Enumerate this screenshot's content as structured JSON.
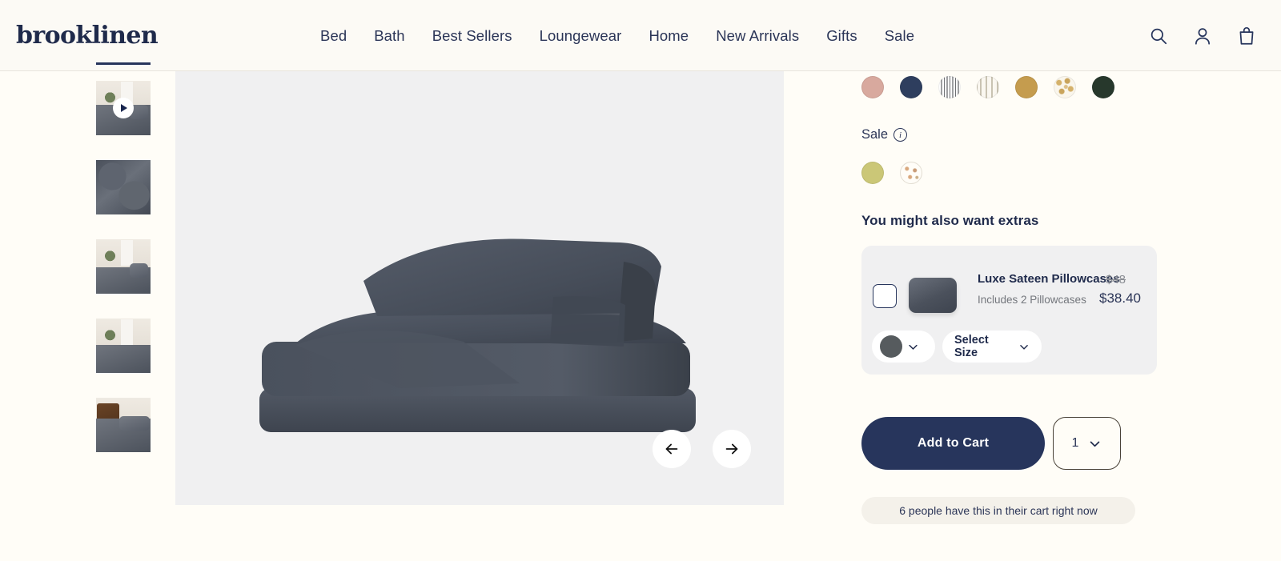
{
  "brand": {
    "logo_text": "brooklinen",
    "navy": "#27355C",
    "page_bg": "#FFFDF7"
  },
  "header": {
    "nav_items": [
      {
        "label": "Bed"
      },
      {
        "label": "Bath"
      },
      {
        "label": "Best Sellers"
      },
      {
        "label": "Loungewear"
      },
      {
        "label": "Home"
      },
      {
        "label": "New Arrivals"
      },
      {
        "label": "Gifts"
      },
      {
        "label": "Sale"
      }
    ],
    "icons": [
      {
        "name": "search-icon"
      },
      {
        "name": "account-icon"
      },
      {
        "name": "cart-bag-icon"
      }
    ]
  },
  "gallery": {
    "thumbnails": [
      {
        "name": "thumbnail-1-active",
        "kind": "active-indicator"
      },
      {
        "name": "thumbnail-2-video",
        "kind": "bedroom-video"
      },
      {
        "name": "thumbnail-3",
        "kind": "fabric-closeup"
      },
      {
        "name": "thumbnail-4",
        "kind": "bedroom-scene"
      },
      {
        "name": "thumbnail-5",
        "kind": "bedroom-scene"
      },
      {
        "name": "thumbnail-6",
        "kind": "headboard-scene"
      }
    ],
    "prev_label": "←",
    "next_label": "→",
    "hero_alt": "Stack of folded dark slate sheets"
  },
  "product": {
    "colors": [
      {
        "name": "blush",
        "hex": "#D8A99E",
        "type": "solid"
      },
      {
        "name": "navy",
        "hex": "#2E3E5E",
        "type": "solid"
      },
      {
        "name": "gray-stripe",
        "hex": "#9FA0A2",
        "type": "stripe-gray"
      },
      {
        "name": "beige-stripe",
        "hex": "#C9C3B2",
        "type": "stripe-beige"
      },
      {
        "name": "gold",
        "hex": "#C59C4E",
        "type": "solid"
      },
      {
        "name": "gold-floral",
        "hex": "#D4B16A",
        "type": "floral-gold"
      },
      {
        "name": "forest-green",
        "hex": "#27382C",
        "type": "solid"
      }
    ],
    "sale": {
      "label": "Sale",
      "info_icon": "info-icon",
      "colors": [
        {
          "name": "olive",
          "hex": "#CBC777",
          "type": "solid"
        },
        {
          "name": "white-floral",
          "hex": "#FFFDF8",
          "type": "floral-white"
        }
      ]
    }
  },
  "extras": {
    "heading": "You might also want extras",
    "item": {
      "name": "Luxe Sateen Pillowcases",
      "original_price": "$48",
      "subtitle": "Includes 2 Pillowcases",
      "sale_price": "$38.40",
      "checkbox_checked": false,
      "color_swatch_hex": "#565B5E",
      "size_label": "Select Size"
    }
  },
  "cta": {
    "add_to_cart_label": "Add to Cart",
    "quantity": "1",
    "social_proof": "6 people have this in their cart right now"
  }
}
